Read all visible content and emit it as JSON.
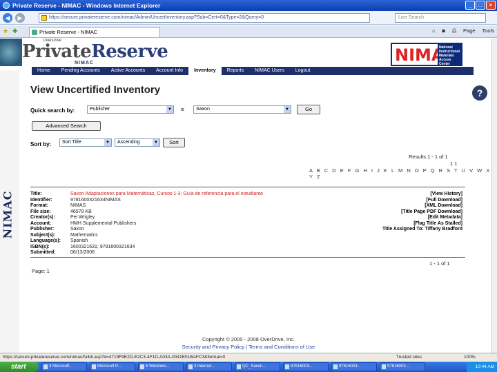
{
  "window": {
    "title": "Private Reserve - NIMAC - Windows Internet Explorer",
    "url": "https://secure.privatereserve.com/nimac/Admin/UncertInventory.asp?Sub=Cert=0&Type=2&Query=0",
    "search_placeholder": "Live Search",
    "tab_label": "Private Reserve - NIMAC",
    "tools": [
      "Page",
      "Tools"
    ]
  },
  "header": {
    "overdrive": "OverDrive",
    "brand_left": "Private",
    "brand_right": "Reserve",
    "brand_sub": "NIMAC",
    "nimac_logo": "NIMAC",
    "nimac_logo_sub": "National Instructional Materials Access Center",
    "side_label": "NIMAC"
  },
  "nav": [
    "Home",
    "Pending Accounts",
    "Active Accounts",
    "Account Info",
    "Inventory",
    "Reports",
    "NIMAC Users",
    "Logout"
  ],
  "nav_active": "Inventory",
  "page": {
    "title": "View Uncertified Inventory",
    "quick_search_label": "Quick search by:",
    "quick_search_field": "Publisher",
    "equals": "=",
    "quick_search_value": "Saxon",
    "go_label": "Go",
    "advanced_label": "Advanced Search",
    "sort_label": "Sort by:",
    "sort_field": "Sort Title",
    "sort_order": "Ascending",
    "sort_button": "Sort",
    "results_top": "Results 1 - 1 of 1",
    "page_nums_top": "1  1",
    "alphabet": "A B C D E F G H I J K L M N O P Q R S T U V W X Y Z",
    "results_bottom": "1 - 1 of 1",
    "page_label": "Page: 1"
  },
  "record": {
    "fields": [
      {
        "k": "Title:",
        "v": "Saxon Adaptaciones para Matemáticas, Cursos 1-3: Guía de referencia para el estudiante",
        "red": true
      },
      {
        "k": "Identifier:",
        "v": "9781600321634NIMAS"
      },
      {
        "k": "Format:",
        "v": "NIMAS"
      },
      {
        "k": "File size:",
        "v": "46578 KB"
      },
      {
        "k": "Creator(s):",
        "v": "Pei Wrigley"
      },
      {
        "k": "Account:",
        "v": "HMH Supplemental Publishers"
      },
      {
        "k": "Publisher:",
        "v": "Saxon"
      },
      {
        "k": "Subject(s):",
        "v": "Mathematics"
      },
      {
        "k": "Language(s):",
        "v": "Spanish"
      },
      {
        "k": "ISBN(s):",
        "v": "1600321631; 9781600321634"
      },
      {
        "k": "Submitted:",
        "v": "06/13/2008"
      }
    ],
    "actions": [
      "[View History]",
      "[Full Download]",
      "[XML Download]",
      "[Title Page PDF Download]",
      "[Edit Metadata]",
      "[Flag Title As Stalled]",
      "Title Assigned To: Tiffany Bradford"
    ]
  },
  "footer": {
    "copyright": "Copyright © 2000 - 2008 OverDrive, Inc.",
    "links": "Security and Privacy Policy | Terms and Conditions of Use"
  },
  "status": {
    "text": "https://secure.privatereserve.com/nimac/fulldl.asp?d=4719F9E2D-E2C3-4F1D-A03A-0041E01BAFC3&format=0",
    "zone": "Trusted sites",
    "zoom": "100%"
  },
  "taskbar": {
    "start": "start",
    "tasks": [
      "3 Microsoft...",
      "Microsoft P...",
      "6 Windows...",
      "3 Internet...",
      "QC_Saxon...",
      "97816003...",
      "97816003...",
      "97816003..."
    ],
    "clock": "10:44 AM"
  }
}
